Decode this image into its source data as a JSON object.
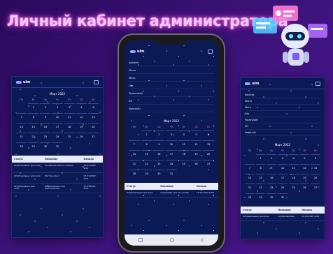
{
  "page": {
    "title": "Личный кабинет администратора"
  },
  "brand": {
    "logo_text": "ulm"
  },
  "phone": {
    "menu": [
      "kabinet",
      "Menu",
      "Mero",
      "Otz",
      "Polzovateli",
      "Kfl",
      "Nastroiki"
    ],
    "calendar": {
      "month": "Март 2022",
      "weekdays": [
        "Пн",
        "Вт",
        "Ср",
        "Чт",
        "Пт",
        "Сб",
        "Вс"
      ],
      "weeks": [
        [
          "",
          "1",
          "2",
          "3",
          "4",
          "5",
          "6"
        ],
        [
          "7",
          "8",
          "9",
          "10",
          "11",
          "12",
          "13"
        ],
        [
          "14",
          "15",
          "16",
          "17",
          "18",
          "19",
          "20"
        ],
        [
          "21",
          "22",
          "23",
          "24",
          "25",
          "26",
          "27"
        ],
        [
          "28",
          "29",
          "30",
          "31",
          "",
          "",
          ""
        ]
      ]
    },
    "table": {
      "headers": [
        "Статус",
        "Название",
        "Начало"
      ],
      "rows": [
        [
          "Опубликовано для всех",
          "Соревнова ние по гонкам",
          "15.03.2022 9:00"
        ]
      ]
    }
  },
  "left": {
    "calendar": {
      "month": "Март 2022",
      "weekdays": [
        "Пн",
        "Вт",
        "Ср",
        "Чт",
        "Пт",
        "Сб",
        "Вс"
      ],
      "weeks": [
        [
          "",
          "1",
          "2",
          "3",
          "4",
          "5",
          "6"
        ],
        [
          "7",
          "8",
          "9",
          "10",
          "11",
          "12",
          "13"
        ],
        [
          "14",
          "15",
          "16",
          "17",
          "18",
          "19",
          "20"
        ],
        [
          "21",
          "22",
          "23",
          "24",
          "25",
          "26",
          "27"
        ],
        [
          "28",
          "29",
          "30",
          "31",
          "",
          "",
          ""
        ]
      ]
    },
    "table": {
      "headers": [
        "Статус",
        "Название",
        "Начало"
      ],
      "rows": [
        [
          "Опубликовано для всех",
          "Соревнова ние по гонкам",
          "15.03.2022 9:00"
        ],
        [
          "Опубликовано для всех",
          "Мастер-класс",
          "17.03.2022 9:00"
        ],
        [
          "Опубликовано для сотр.",
          "Информацион ное мероприятие",
          "17.03.2022 9:00"
        ]
      ]
    }
  },
  "right": {
    "menu": [
      "kabinet",
      "Menu",
      "Mero",
      "Otz",
      "Polzovateli",
      "Kfl",
      "Nastroiki"
    ],
    "calendar": {
      "month": "Март 2022",
      "weekdays": [
        "Пн",
        "Вт",
        "Ср",
        "Чт",
        "Пт",
        "Сб",
        "Вс"
      ],
      "weeks": [
        [
          "",
          "1",
          "2",
          "3",
          "4",
          "5",
          "6"
        ],
        [
          "7",
          "8",
          "9",
          "10",
          "11",
          "12",
          "13"
        ],
        [
          "14",
          "15",
          "16",
          "17",
          "18",
          "19",
          "20"
        ],
        [
          "21",
          "22",
          "23",
          "24",
          "25",
          "26",
          "27"
        ],
        [
          "28",
          "29",
          "30",
          "31",
          "",
          "",
          ""
        ]
      ]
    },
    "table": {
      "headers": [
        "Статус",
        "Название",
        "Начало"
      ],
      "rows": [
        [
          "Опубликовано для всех",
          "Соревнова ние",
          "15.03.2022 9:00"
        ]
      ]
    }
  },
  "colors": {
    "accent": "#ff5ed8",
    "screen_bg": "#0b1a55",
    "weekend": "#ff6b9a"
  }
}
